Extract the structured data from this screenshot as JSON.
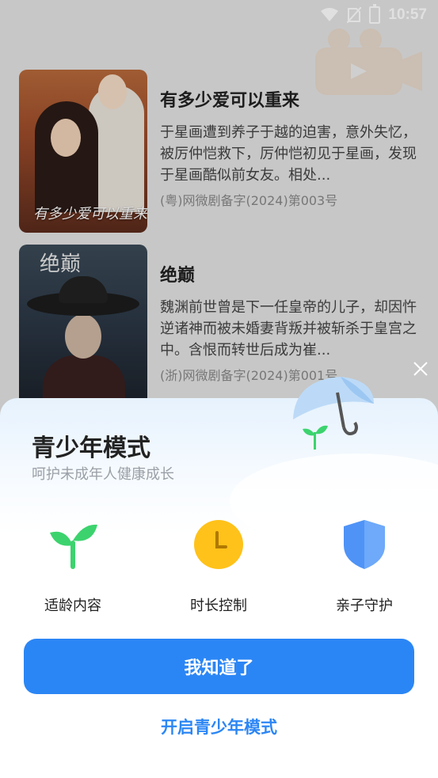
{
  "status_bar": {
    "time": "10:57"
  },
  "dramas": [
    {
      "poster_text": "有多少爱可以重来",
      "title": "有多少爱可以重来",
      "description": "于星画遭到养子于越的迫害，意外失忆，被厉仲恺救下，厉仲恺初见于星画，发现于星画酷似前女友。相处...",
      "license": "(粤)网微剧备字(2024)第003号"
    },
    {
      "poster_text": "绝巅",
      "title": "绝巅",
      "description": "魏渊前世曾是下一任皇帝的儿子，却因忤逆诸神而被未婚妻背叛并被斩杀于皇宫之中。含恨而转世后成为崔...",
      "license": "(浙)网微剧备字(2024)第001号"
    }
  ],
  "sheet": {
    "title": "青少年模式",
    "subtitle": "呵护未成年人健康成长",
    "features": [
      {
        "label": "适龄内容",
        "icon": "sprout-icon"
      },
      {
        "label": "时长控制",
        "icon": "clock-icon"
      },
      {
        "label": "亲子守护",
        "icon": "shield-icon"
      }
    ],
    "primary_button": "我知道了",
    "link_button": "开启青少年模式"
  },
  "colors": {
    "accent": "#2b86f5",
    "green": "#3cd36e",
    "yellow": "#ffc21a",
    "shield": "#4f93f7"
  }
}
